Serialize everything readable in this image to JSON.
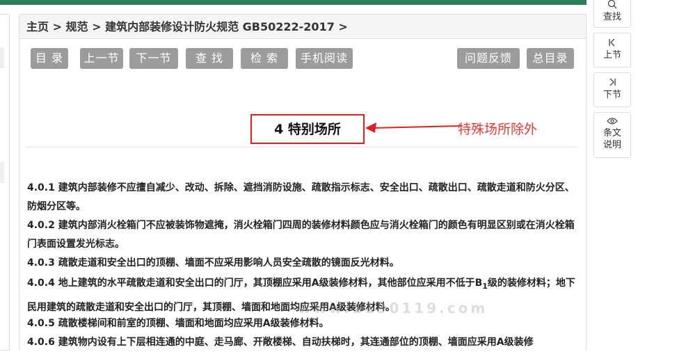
{
  "breadcrumb": "主页 > 规范 > 建筑内部装修设计防火规范 GB50222-2017 >",
  "toolbar": {
    "toc": "目 录",
    "prev": "上一节",
    "next": "下一节",
    "find": "查 找",
    "search": "检 索",
    "mobile": "手机阅读",
    "feedback": "问题反馈",
    "master_toc": "总目录"
  },
  "chapter_title": "4 特别场所",
  "annotation": "特殊场所除外",
  "clauses": [
    {
      "num": "4.0.1",
      "text": "建筑内部装修不应擅自减少、改动、拆除、遮挡消防设施、疏散指示标志、安全出口、疏散出口、疏散走道和防火分区、防烟分区等。"
    },
    {
      "num": "4.0.2",
      "text": "建筑内部消火栓箱门不应被装饰物遮掩，消火栓箱门四周的装修材料颜色应与消火栓箱门的颜色有明显区别或在消火栓箱门表面设置发光标志。"
    },
    {
      "num": "4.0.3",
      "text": "疏散走道和安全出口的顶棚、墙面不应采用影响人员安全疏散的镜面反光材料。"
    },
    {
      "num": "4.0.4",
      "text_a": "地上建筑的水平疏散走道和安全出口的门厅，其顶棚应采用A级装修材料，其他部位应采用不低于B",
      "sub": "1",
      "text_b": "级的装修材料；地下民用建筑的疏散走道和安全出口的门厅，其顶棚、墙面和地面均应采用A级装修材料。"
    },
    {
      "num": "4.0.5",
      "text": "疏散楼梯间和前室的顶棚、墙面和地面均应采用A级装修材料。"
    },
    {
      "num": "4.0.6",
      "text": "建筑物内设有上下层相连通的中庭、走马廊、开敞楼梯、自动扶梯时，其连通部位的顶棚、墙面应采用A级装修"
    }
  ],
  "watermark": "www.1190119.com",
  "side_nav": [
    {
      "icon": "search-icon",
      "label": "查找"
    },
    {
      "icon": "prev-section-icon",
      "label": "上节"
    },
    {
      "icon": "next-section-icon",
      "label": "下节"
    },
    {
      "icon": "eye-icon",
      "label_1": "条文",
      "label_2": "说明"
    }
  ],
  "colors": {
    "header_bar": "#2e7d5b",
    "button": "#9c9c9c",
    "highlight": "#e02020",
    "annotation": "#e53935"
  }
}
